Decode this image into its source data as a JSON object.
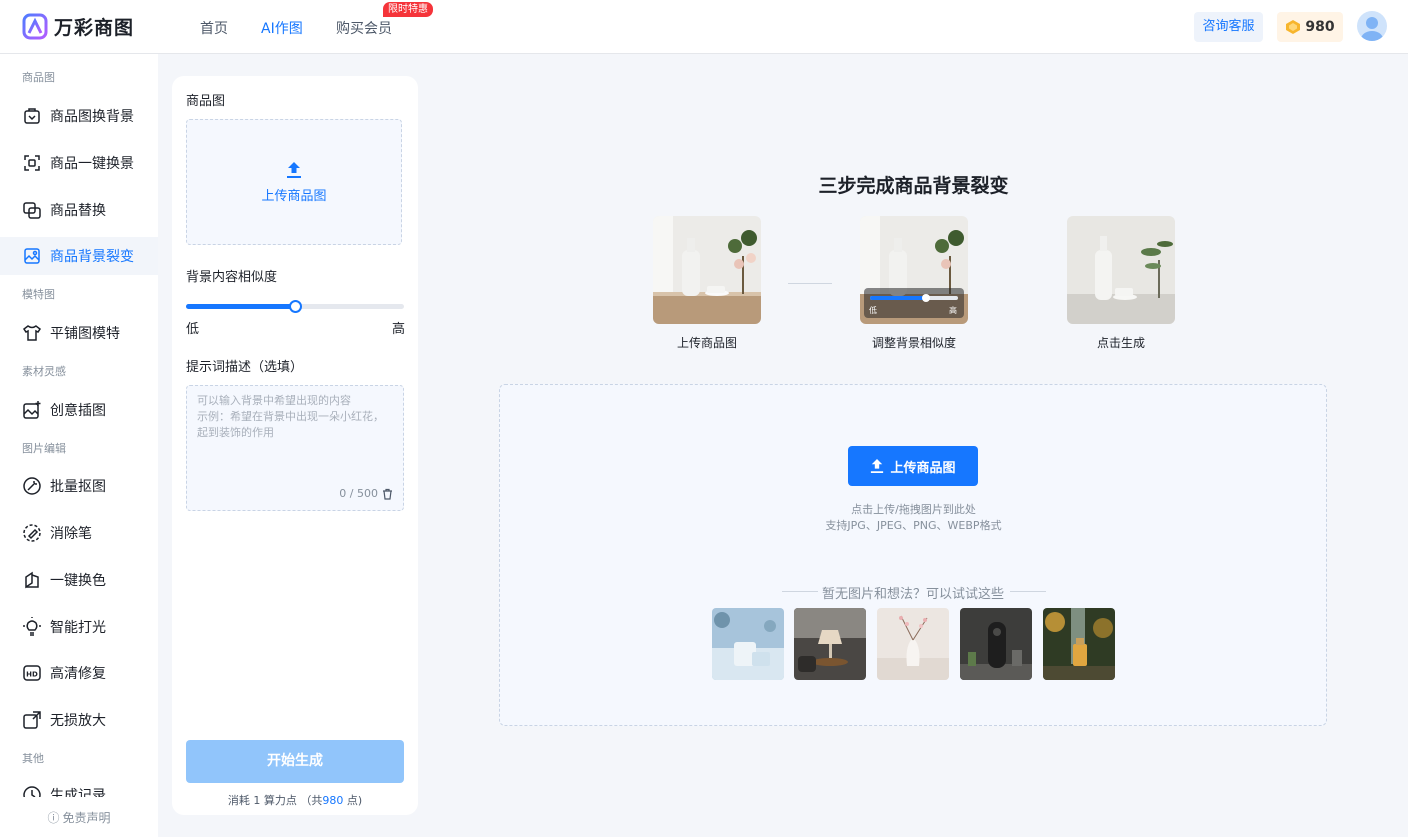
{
  "header": {
    "brand": "万彩商图",
    "nav": [
      "首页",
      "AI作图",
      "购买会员"
    ],
    "nav_badge": "限时特惠",
    "service": "咨询客服",
    "coins": "980"
  },
  "sidebar": {
    "sections": [
      "商品图",
      "模特图",
      "素材灵感",
      "图片编辑",
      "其他"
    ],
    "items": [
      "商品图换背景",
      "商品一键换景",
      "商品替换",
      "商品背景裂变",
      "平铺图模特",
      "创意插图",
      "批量抠图",
      "消除笔",
      "一键换色",
      "智能打光",
      "高清修复",
      "无损放大",
      "生成记录"
    ],
    "footer": "免责声明"
  },
  "panel": {
    "product_label": "商品图",
    "upload_label": "上传商品图",
    "similarity_label": "背景内容相似度",
    "similarity_value": 0.5,
    "low": "低",
    "high": "高",
    "prompt_label": "提示词描述（选填）",
    "prompt_placeholder_1": "可以输入背景中希望出现的内容",
    "prompt_placeholder_2": "示例：希望在背景中出现一朵小红花，起到装饰的作用",
    "prompt_count": "0 / 500",
    "generate": "开始生成",
    "cost_prefix": "消耗 1 算力点 （共",
    "cost_total": "980",
    "cost_suffix": " 点)"
  },
  "main": {
    "title": "三步完成商品背景裂变",
    "steps": [
      "上传商品图",
      "调整背景相似度",
      "点击生成"
    ],
    "step_slider_low": "低",
    "step_slider_high": "高",
    "upload_button": "上传商品图",
    "hint_1": "点击上传/拖拽图片到此处",
    "hint_2": "支持JPG、JPEG、PNG、WEBP格式",
    "try_title": "暂无图片和想法？可以试试这些"
  }
}
